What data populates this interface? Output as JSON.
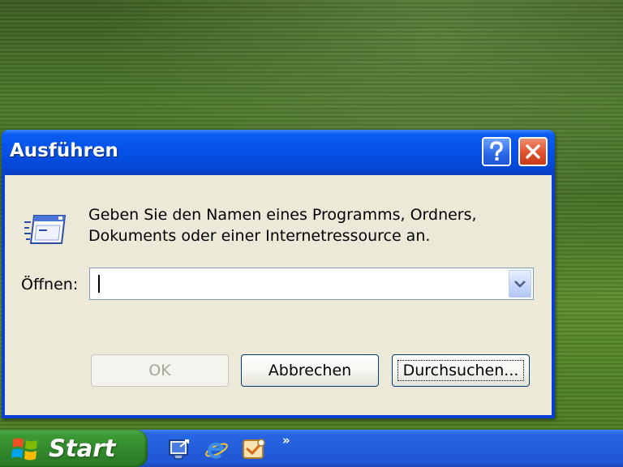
{
  "dialog": {
    "title": "Ausführen",
    "description_line1": "Geben Sie den Namen eines Programms, Ordners,",
    "description_line2": "Dokuments oder einer Internetressource an.",
    "open_label": "Öffnen:",
    "open_value": "",
    "buttons": {
      "ok": "OK",
      "cancel": "Abbrechen",
      "browse": "Durchsuchen..."
    },
    "icons": {
      "help": "help-icon",
      "close": "close-icon",
      "run": "run-dialog-icon",
      "dropdown": "chevron-down-icon"
    }
  },
  "taskbar": {
    "start_label": "Start",
    "quick_launch": [
      "show-desktop-icon",
      "internet-explorer-icon",
      "outlook-express-icon"
    ],
    "overflow": "»"
  },
  "colors": {
    "title_bar": "#0552e8",
    "dialog_bg": "#ece9d8",
    "close_button": "#e0502c",
    "start_button": "#3c9a35",
    "taskbar": "#245edb"
  }
}
